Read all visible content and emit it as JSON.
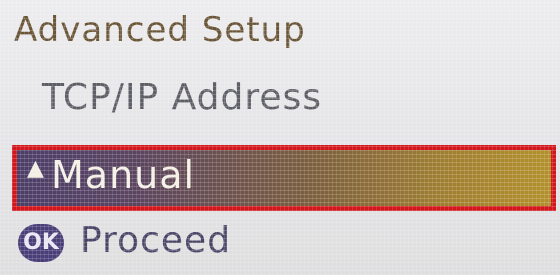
{
  "screen": {
    "title": "Advanced Setup",
    "submenu": "TCP/IP Address",
    "selected_option": {
      "label": "Manual",
      "indicator": "▲"
    },
    "footer": {
      "ok_button": "OK",
      "action_label": "Proceed"
    }
  },
  "colors": {
    "highlight_border": "#d3161c",
    "ok_badge": "#4a3e78",
    "title_text": "#6a5537"
  }
}
